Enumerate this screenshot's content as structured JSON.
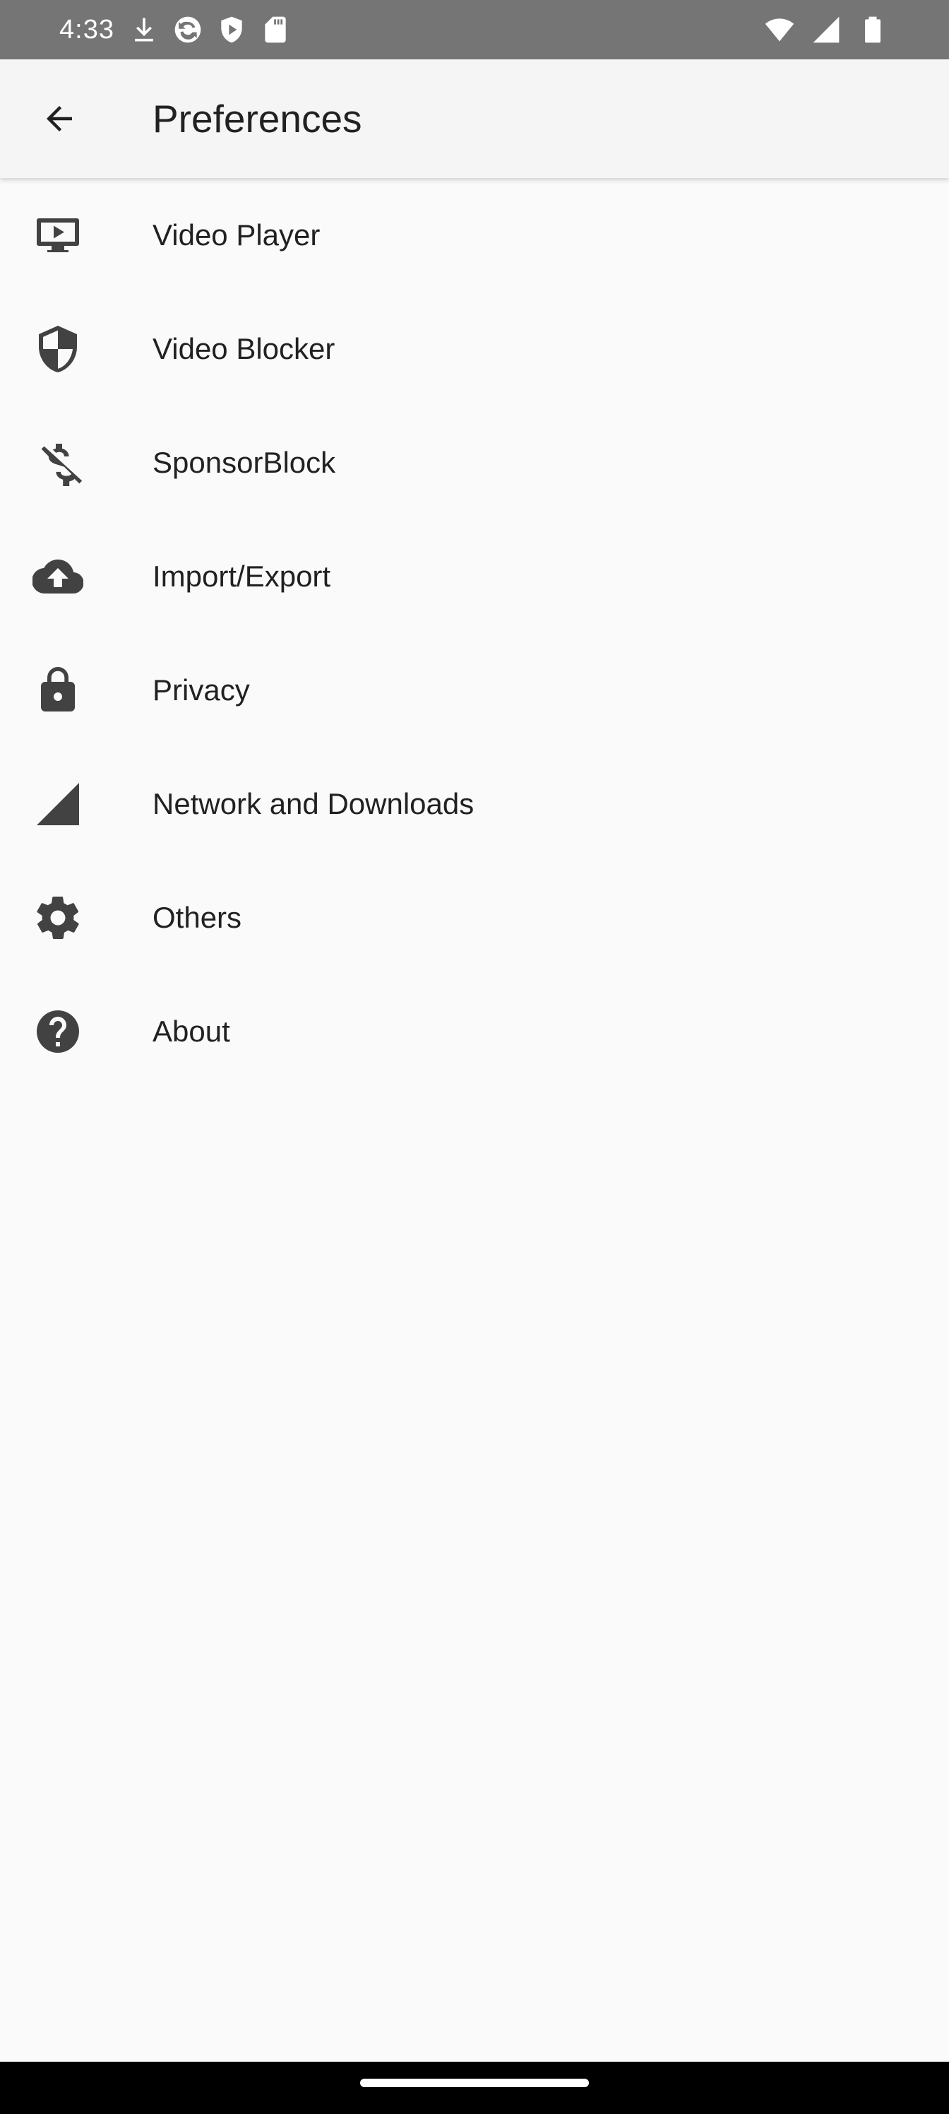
{
  "status_bar": {
    "time": "4:33",
    "left_icons": [
      "download-icon",
      "sync-icon",
      "shield-play-icon",
      "sd-card-icon"
    ],
    "right_icons": [
      "wifi-icon",
      "cellular-signal-icon",
      "battery-icon"
    ]
  },
  "app_bar": {
    "title": "Preferences",
    "back_icon": "arrow-back-icon"
  },
  "preferences": [
    {
      "label": "Video Player",
      "icon": "tv-play-icon"
    },
    {
      "label": "Video Blocker",
      "icon": "shield-icon"
    },
    {
      "label": "SponsorBlock",
      "icon": "money-off-icon"
    },
    {
      "label": "Import/Export",
      "icon": "cloud-upload-icon"
    },
    {
      "label": "Privacy",
      "icon": "lock-icon"
    },
    {
      "label": "Network and Downloads",
      "icon": "signal-icon"
    },
    {
      "label": "Others",
      "icon": "gear-icon"
    },
    {
      "label": "About",
      "icon": "help-icon"
    }
  ],
  "colors": {
    "status_bar": "#757575",
    "app_bar": "#f5f5f5",
    "background": "#fafafa",
    "text": "#212121",
    "icon": "#424242",
    "nav_bar": "#000000"
  }
}
